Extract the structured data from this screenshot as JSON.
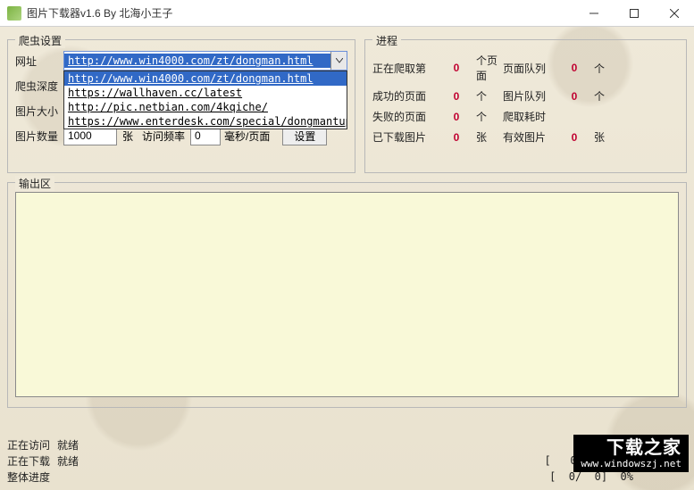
{
  "window": {
    "title": "图片下载器v1.6 By 北海小王子"
  },
  "crawler": {
    "legend": "爬虫设置",
    "url_label": "网址",
    "url_value": "http://www.win4000.com/zt/dongman.html",
    "url_options": [
      "http://www.win4000.com/zt/dongman.html",
      "https://wallhaven.cc/latest",
      "http://pic.netbian.com/4kqiche/",
      "https://www.enterdesk.com/special/dongmantupian/"
    ],
    "depth_label": "爬虫深度",
    "size_label": "图片大小",
    "count_label": "图片数量",
    "count_value": "1000",
    "count_unit": "张",
    "freq_label": "访问频率",
    "freq_value": "0",
    "freq_unit": "毫秒/页面",
    "settings_btn": "设置"
  },
  "progress": {
    "legend": "进程",
    "rows": [
      {
        "k1": "正在爬取第",
        "v1": "0",
        "u1": "个页面",
        "k2": "页面队列",
        "v2": "0",
        "u2": "个"
      },
      {
        "k1": "成功的页面",
        "v1": "0",
        "u1": "个",
        "k2": "图片队列",
        "v2": "0",
        "u2": "个"
      },
      {
        "k1": "失败的页面",
        "v1": "0",
        "u1": "个",
        "k2": "爬取耗时",
        "v2": "",
        "u2": ""
      },
      {
        "k1": "已下载图片",
        "v1": "0",
        "u1": "张",
        "k2": "有效图片",
        "v2": "0",
        "u2": "张"
      }
    ]
  },
  "output": {
    "legend": "输出区",
    "text": ""
  },
  "status": {
    "visit_label": "正在访问",
    "visit_value": "就绪",
    "download_label": "正在下载",
    "download_value": "就绪",
    "speed": "[   0 KB/s]",
    "overall_label": "整体进度",
    "overall_metric": "[  0/  0]  0%"
  },
  "watermark": {
    "big": "下载之家",
    "small": "www.windowszj.net"
  }
}
